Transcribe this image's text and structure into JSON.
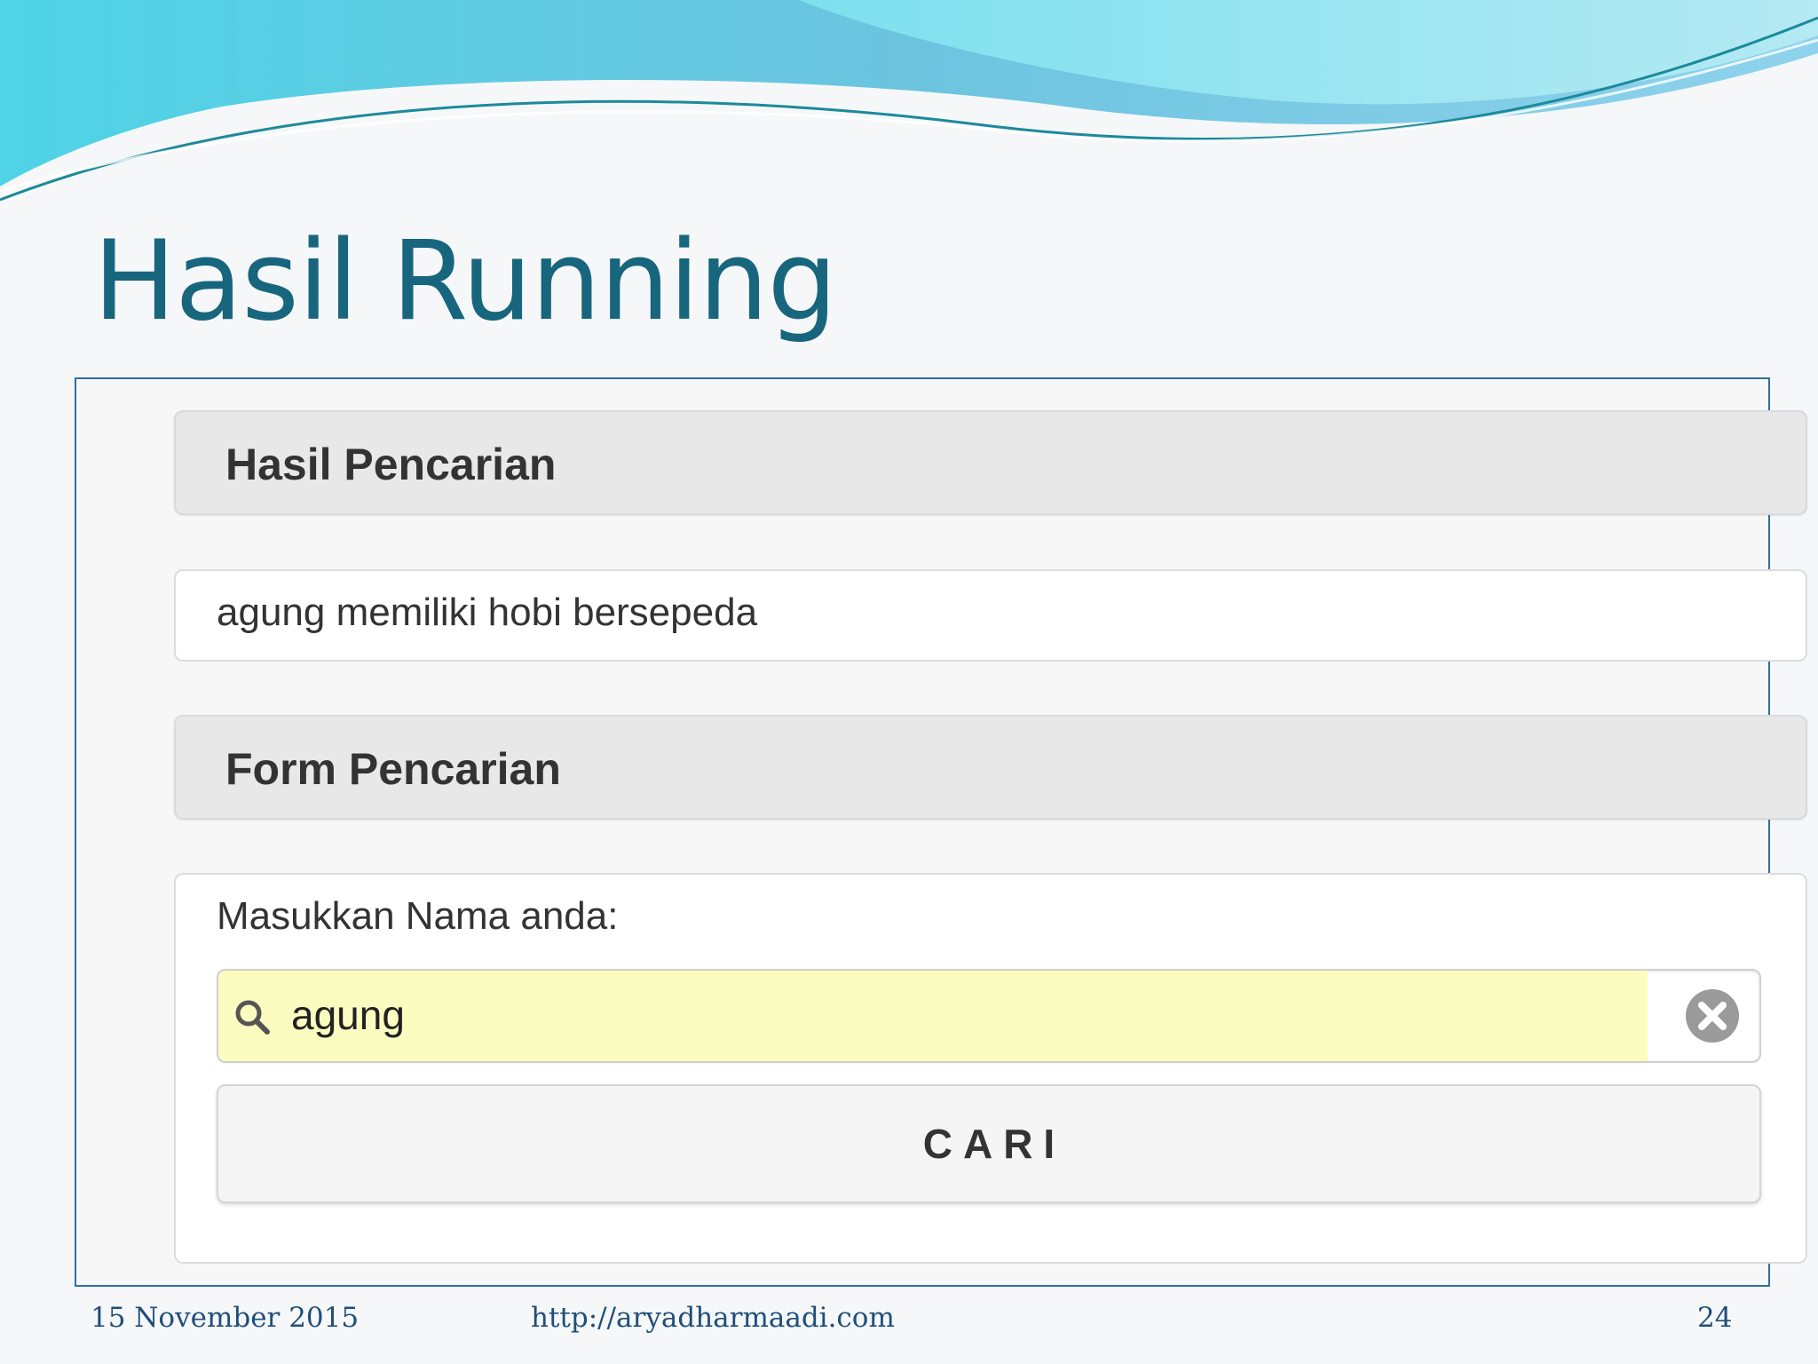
{
  "slide": {
    "title": "Hasil Running"
  },
  "app": {
    "results_header": "Hasil Pencarian",
    "result_text": "agung memiliki hobi bersepeda",
    "form_header": "Form Pencarian",
    "form": {
      "label": "Masukkan Nama anda:",
      "input_value": "agung",
      "submit_label": "CARI"
    }
  },
  "footer": {
    "date": "15 November 2015",
    "url": "http://aryadharmaadi.com",
    "page_number": "24"
  },
  "colors": {
    "title": "#17667e",
    "input_highlight": "#fbfdc0",
    "frame_border": "#2f6f9f"
  },
  "icons": {
    "search": "search-icon",
    "clear": "clear-icon"
  }
}
